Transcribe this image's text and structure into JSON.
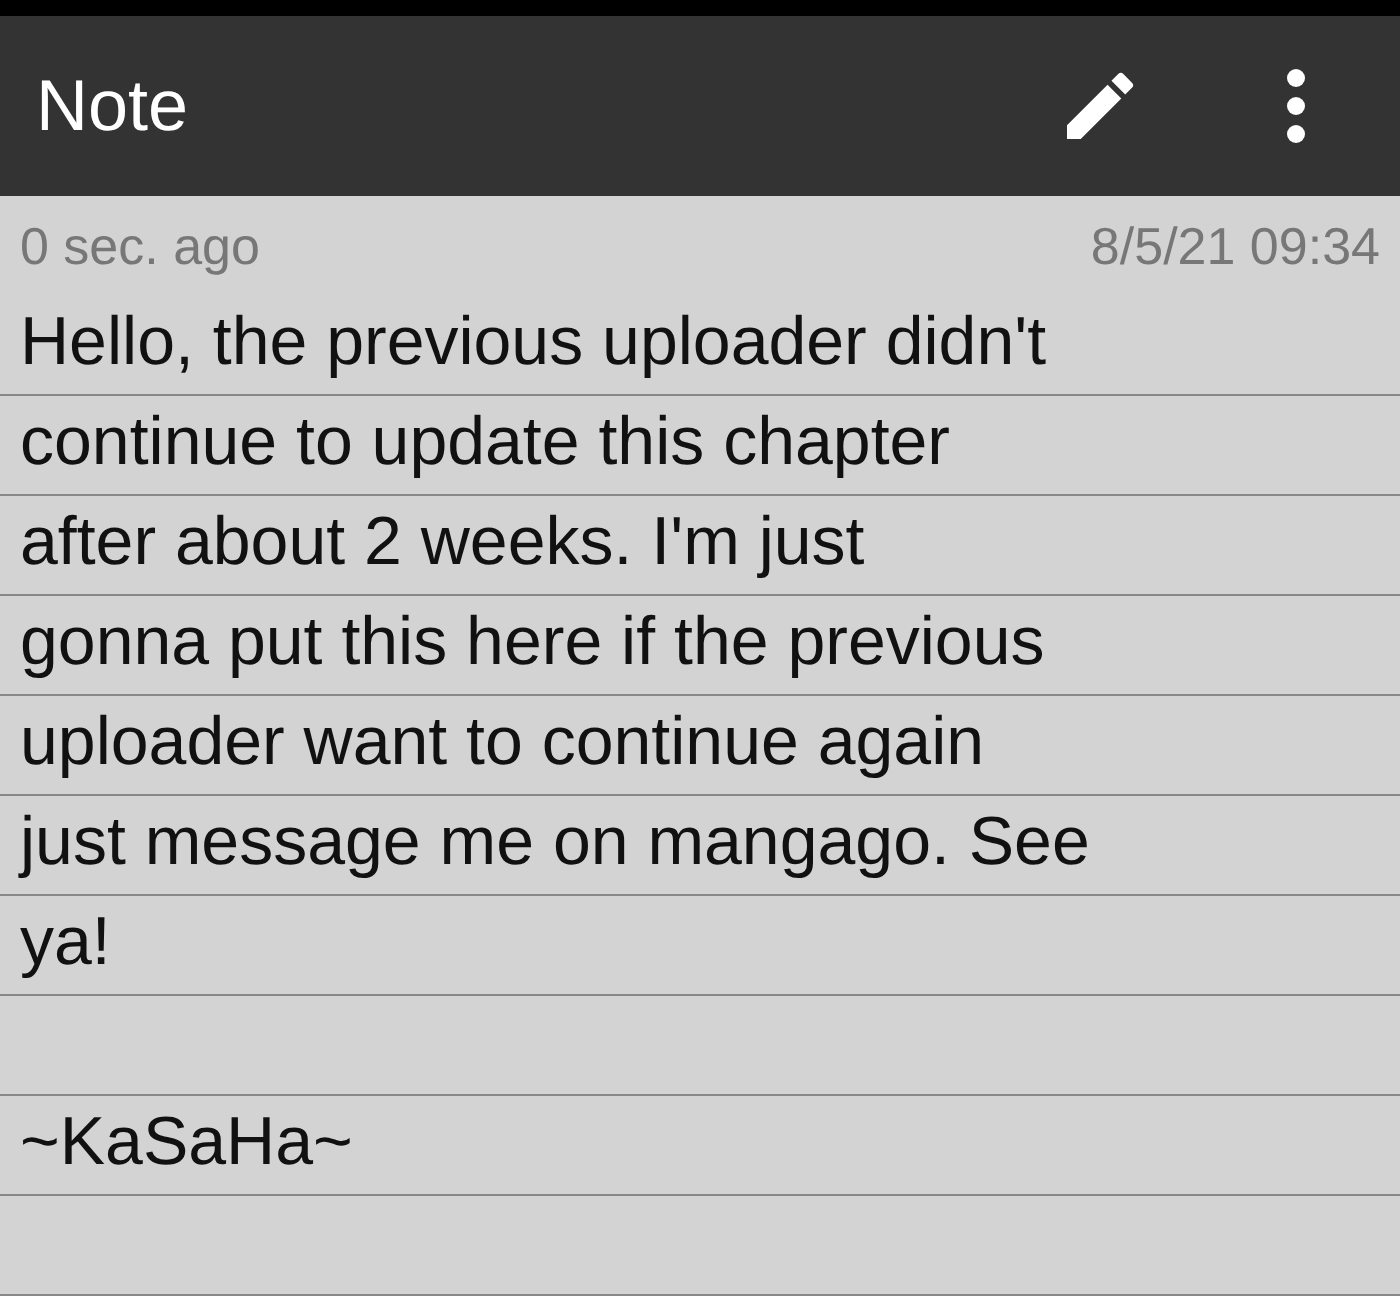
{
  "app_bar": {
    "title": "Note"
  },
  "meta": {
    "edited": "0 sec. ago",
    "date": "8/5/21 09:34"
  },
  "lines": [
    "Hello, the previous uploader didn't",
    "continue to update this chapter",
    "after about 2 weeks. I'm just",
    "gonna put this here if the previous",
    "uploader want to continue again",
    "just message me on mangago. See",
    "ya!"
  ],
  "signature": "~KaSaHa~"
}
